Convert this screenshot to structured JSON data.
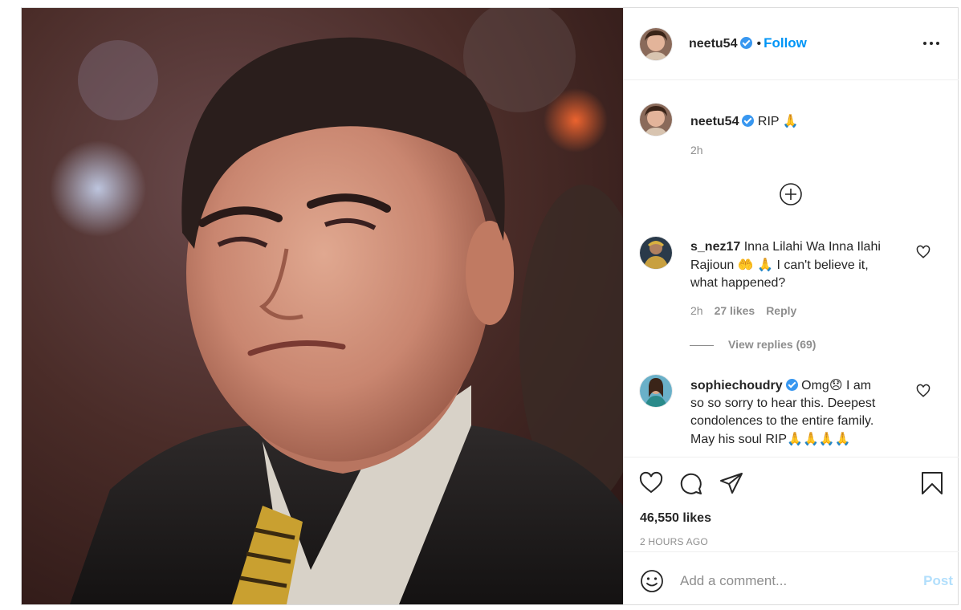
{
  "post": {
    "author": "neetu54",
    "follow_label": "Follow",
    "separator": "•",
    "caption": {
      "username": "neetu54",
      "text": "RIP",
      "emoji": "🙏",
      "age": "2h"
    },
    "likes": "46,550 likes",
    "timestamp": "2 HOURS AGO"
  },
  "comments": [
    {
      "username": "s_nez17",
      "lines": [
        "Inna Lilahi Wa Inna Ilahi",
        "Rajioun",
        "I can't believe it,",
        "what happened?"
      ],
      "emoji": [
        "🤲",
        "🙏"
      ],
      "age": "2h",
      "likes": "27 likes",
      "reply_label": "Reply",
      "view_replies": "View replies (69)"
    },
    {
      "username": "sophiechoudry",
      "lines": [
        "Omg",
        "I am",
        "so so sorry to hear this. Deepest",
        "condolences to the entire family.",
        "May his soul RIP"
      ],
      "emoji": [
        "😞",
        "🙏🙏🙏🙏"
      ]
    }
  ],
  "add_comment": {
    "placeholder": "Add a comment...",
    "post_label": "Post"
  },
  "icons": [
    "more-options-icon",
    "verified-badge-icon",
    "load-more-icon",
    "like-icon",
    "comment-icon",
    "share-icon",
    "save-icon",
    "emoji-icon"
  ],
  "colors": {
    "follow": "#0095f6",
    "verified": "#3897f0",
    "post_disabled": "#b2dffc",
    "meta": "#8e8e8e"
  }
}
